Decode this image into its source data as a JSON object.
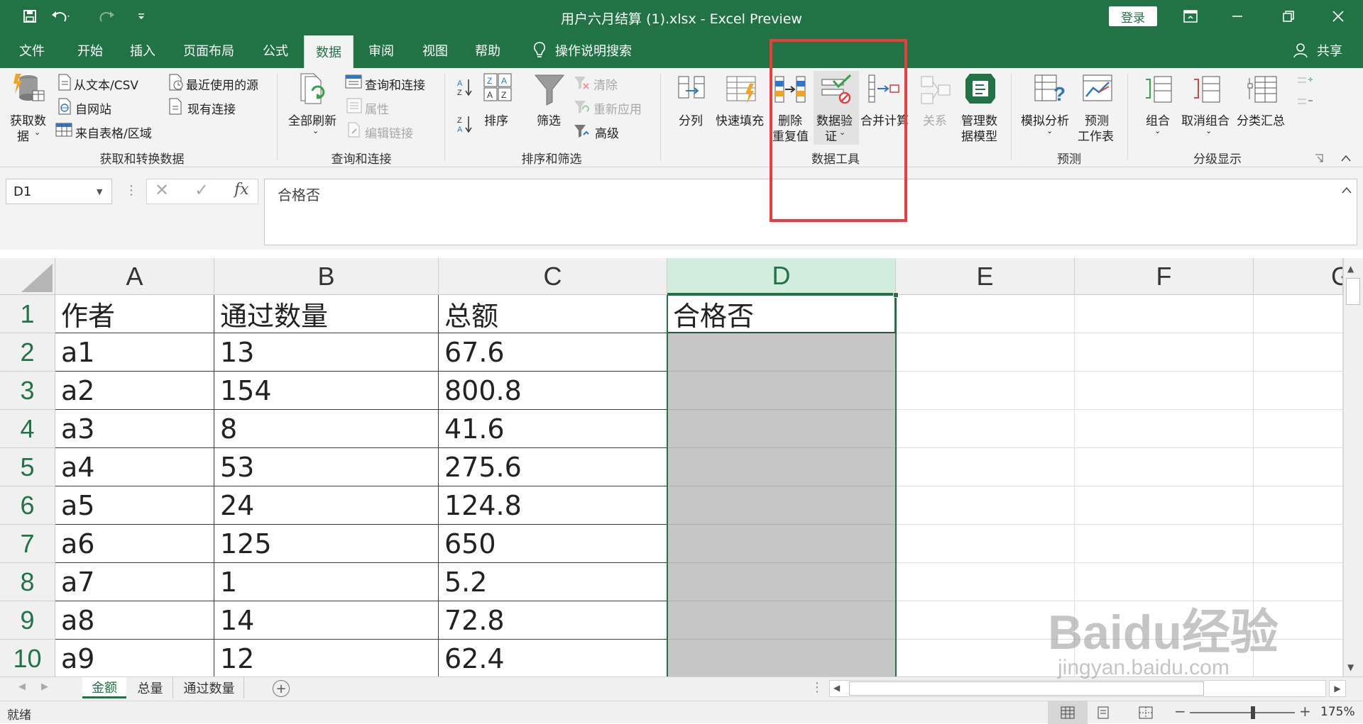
{
  "window": {
    "title": "用户六月结算 (1).xlsx  -  Excel Preview",
    "login_label": "登录",
    "share_label": "共享"
  },
  "menu_tabs": [
    "文件",
    "开始",
    "插入",
    "页面布局",
    "公式",
    "数据",
    "审阅",
    "视图",
    "帮助"
  ],
  "active_tab": "数据",
  "tell_me": "操作说明搜索",
  "ribbon": {
    "get_transform": {
      "label": "获取和转换数据",
      "get_data": [
        "获取数",
        "据"
      ],
      "from_csv": "从文本/CSV",
      "from_web": "自网站",
      "from_table": "来自表格/区域",
      "recent_sources": "最近使用的源",
      "existing_connections": "现有连接"
    },
    "queries": {
      "label": "查询和连接",
      "refresh_all": "全部刷新",
      "queries_connections": "查询和连接",
      "properties": "属性",
      "edit_links": "编辑链接"
    },
    "sort_filter": {
      "label": "排序和筛选",
      "sort": "排序",
      "filter": "筛选",
      "clear": "清除",
      "reapply": "重新应用",
      "advanced": "高级"
    },
    "data_tools": {
      "label": "数据工具",
      "text_to_columns": "分列",
      "flash_fill": "快速填充",
      "remove_duplicates": [
        "删除",
        "重复值"
      ],
      "data_validation": [
        "数据验",
        "证"
      ],
      "consolidate": "合并计算",
      "relationships": "关系",
      "manage_model": [
        "管理数",
        "据模型"
      ]
    },
    "forecast": {
      "label": "预测",
      "what_if": "模拟分析",
      "forecast_sheet": [
        "预测",
        "工作表"
      ]
    },
    "outline": {
      "label": "分级显示",
      "group": "组合",
      "ungroup": "取消组合",
      "subtotal": "分类汇总"
    }
  },
  "formula_bar": {
    "name_box": "D1",
    "formula": "合格否"
  },
  "columns": [
    "A",
    "B",
    "C",
    "D",
    "E",
    "F"
  ],
  "selected_column": "D",
  "row_numbers": [
    "1",
    "2",
    "3",
    "4",
    "5",
    "6",
    "7",
    "8",
    "9",
    "10"
  ],
  "table": [
    [
      "作者",
      "通过数量",
      "总额",
      "合格否"
    ],
    [
      "a1",
      "13",
      "67.6",
      ""
    ],
    [
      "a2",
      "154",
      "800.8",
      ""
    ],
    [
      "a3",
      "8",
      "41.6",
      ""
    ],
    [
      "a4",
      "53",
      "275.6",
      ""
    ],
    [
      "a5",
      "24",
      "124.8",
      ""
    ],
    [
      "a6",
      "125",
      "650",
      ""
    ],
    [
      "a7",
      "1",
      "5.2",
      ""
    ],
    [
      "a8",
      "14",
      "72.8",
      ""
    ],
    [
      "a9",
      "12",
      "62.4",
      ""
    ]
  ],
  "sheets": [
    "金额",
    "总量",
    "通过数量"
  ],
  "active_sheet": "金额",
  "status": {
    "ready": "就绪",
    "zoom": "175%"
  },
  "watermark": {
    "brand": "Baidu经验",
    "url": "jingyan.baidu.com"
  },
  "colors": {
    "excel_green": "#217346",
    "highlight_red": "#ee3b3b",
    "selection_gray": "#c6c6c6"
  }
}
